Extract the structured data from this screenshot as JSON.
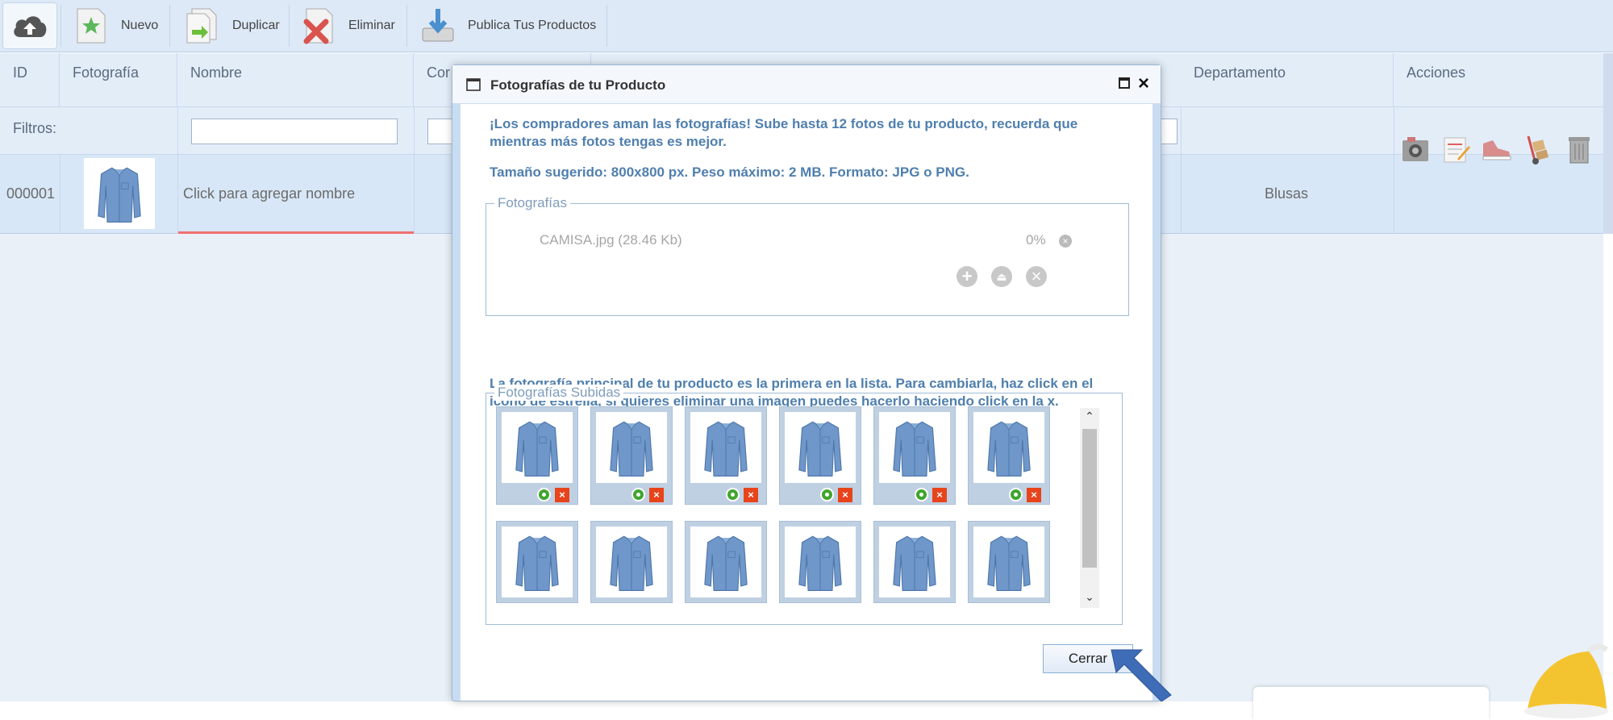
{
  "toolbar": {
    "nuevo": "Nuevo",
    "duplicar": "Duplicar",
    "eliminar": "Eliminar",
    "publica": "Publica Tus Productos"
  },
  "grid": {
    "headers": {
      "id": "ID",
      "fotografia": "Fotografía",
      "nombre": "Nombre",
      "con_partial": "Cor",
      "departamento": "Departamento",
      "acciones": "Acciones"
    },
    "filters_label": "Filtros:",
    "row": {
      "id": "000001",
      "nombre": "Click para agregar nombre",
      "departamento": "Blusas"
    },
    "action_icons": [
      "photo-icon",
      "edit-notes-icon",
      "shoes-icon",
      "hand-truck-icon",
      "trash-icon"
    ]
  },
  "dialog": {
    "title": "Fotografías de tu Producto",
    "intro": "¡Los compradores aman las fotografías! Sube hasta 12 fotos de tu producto, recuerda que mientras más fotos tengas es mejor.",
    "size_info": "Tamaño sugerido: 800x800 px. Peso máximo: 2 MB. Formato: JPG o PNG.",
    "fotografias_legend": "Fotografías",
    "upload_file": {
      "name": "CAMISA.jpg (28.46 Kb)",
      "percent": "0%"
    },
    "main_photo_info": "La fotografía principal de tu producto es la primera en la lista. Para cambiarla, haz click en el icono de estrella, si quieres eliminar una imagen puedes hacerlo haciendo click en la x.",
    "subidas_legend": "Fotografías Subidas",
    "close_button": "Cerrar"
  },
  "colors": {
    "accent_text": "#4f7fae",
    "grid_bg": "#e3edf8",
    "delete_red": "#e8441c",
    "ok_green": "#3fa52d"
  }
}
